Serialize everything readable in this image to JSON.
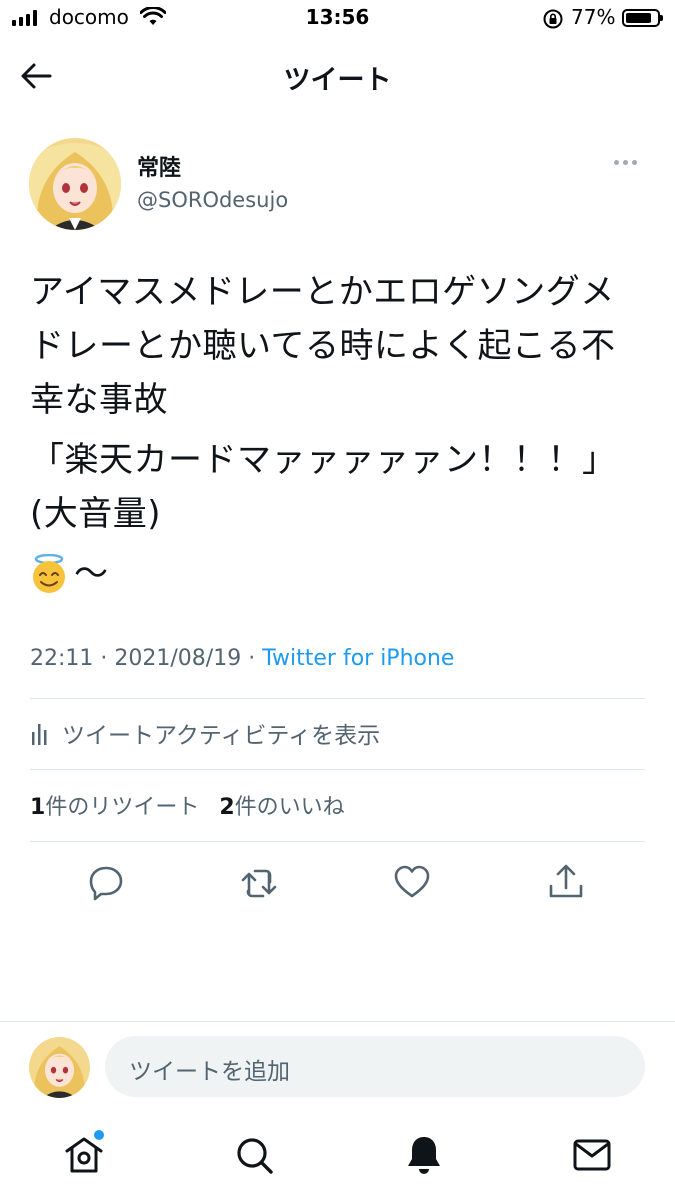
{
  "status_bar": {
    "carrier": "docomo",
    "time": "13:56",
    "battery": "77%",
    "battery_level": 0.77
  },
  "header": {
    "title": "ツイート"
  },
  "tweet": {
    "author_name": "常陸",
    "author_handle": "@SOROdesujo",
    "lines": [
      "アイマスメドレーとかエロゲソングメドレーとか聴いてる時によく起こる不幸な事故",
      "「楽天カードマァァァァァン！！！」(大音量)"
    ],
    "emoji_text": "〜",
    "time": "22:11",
    "date": "2021/08/19",
    "separator": "·",
    "source": "Twitter for iPhone",
    "activity_label": "ツイートアクティビティを表示",
    "retweet_count": "1",
    "retweet_label": "件のリツイート",
    "like_count": "2",
    "like_label": "件のいいね"
  },
  "compose": {
    "placeholder": "ツイートを追加"
  },
  "icons": {
    "back": "back-arrow-icon",
    "reply": "reply-icon",
    "retweet": "retweet-icon",
    "like": "heart-icon",
    "share": "share-icon",
    "home": "home-icon",
    "search": "search-icon",
    "notifications": "bell-icon",
    "messages": "mail-icon"
  },
  "colors": {
    "accent": "#1d9bf0",
    "secondary_text": "#536471"
  }
}
